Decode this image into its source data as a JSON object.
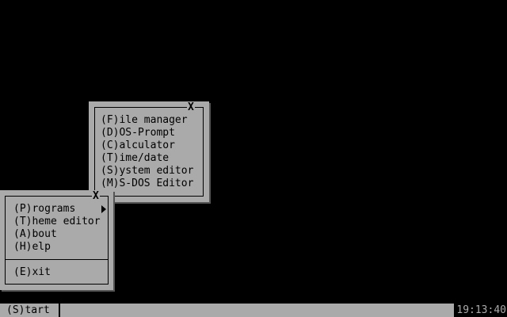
{
  "programs_menu": {
    "close_label": "X",
    "items": [
      {
        "label": "(F)ile manager"
      },
      {
        "label": "(D)OS-Prompt"
      },
      {
        "label": "(C)alculator"
      },
      {
        "label": "(T)ime/date"
      },
      {
        "label": "(S)ystem editor"
      },
      {
        "label": "(M)S-DOS Editor"
      }
    ]
  },
  "start_menu": {
    "close_label": "X",
    "items": [
      {
        "label": "(P)rograms",
        "has_submenu": true
      },
      {
        "label": "(T)heme editor"
      },
      {
        "label": "(A)bout"
      },
      {
        "label": "(H)elp"
      }
    ],
    "exit_label": "(E)xit"
  },
  "taskbar": {
    "start_label": "(S)tart",
    "clock": "19:13:40"
  },
  "colors": {
    "desktop": "#000000",
    "menu_bg": "#aaaaaa",
    "menu_border": "#000000",
    "clock_text": "#aaaaaa"
  }
}
